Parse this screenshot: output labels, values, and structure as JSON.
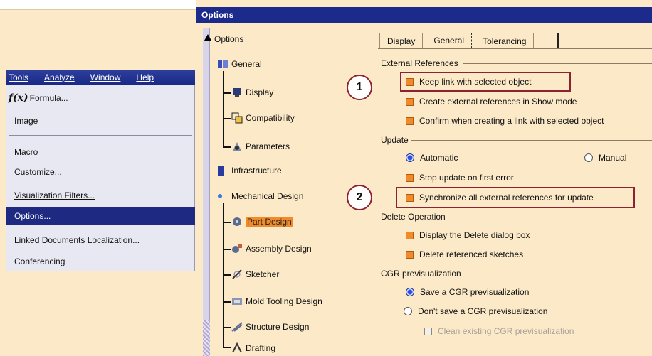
{
  "window_title": "Options",
  "menubar": {
    "items": [
      "Tools",
      "Analyze",
      "Window",
      "Help"
    ]
  },
  "tools_menu": {
    "items": [
      {
        "label": "Formula...",
        "icon": "formula-fx-icon"
      },
      {
        "label": "Image"
      },
      {
        "label": "Macro"
      },
      {
        "label": "Customize..."
      },
      {
        "label": "Visualization Filters..."
      },
      {
        "label": "Options...",
        "selected": true
      },
      {
        "label": "Linked Documents Localization..."
      },
      {
        "label": "Conferencing"
      }
    ]
  },
  "tree": {
    "root": "Options",
    "nodes": [
      {
        "label": "General",
        "icon": "general-icon"
      },
      {
        "label": "Display",
        "icon": "display-icon"
      },
      {
        "label": "Compatibility",
        "icon": "compatibility-icon"
      },
      {
        "label": "Parameters",
        "icon": "parameters-icon"
      },
      {
        "label": "Infrastructure",
        "icon": "infrastructure-icon"
      },
      {
        "label": "Mechanical Design",
        "icon": "mechanical-design-icon"
      },
      {
        "label": "Part Design",
        "icon": "part-design-icon",
        "selected": true
      },
      {
        "label": "Assembly Design",
        "icon": "assembly-design-icon"
      },
      {
        "label": "Sketcher",
        "icon": "sketcher-icon"
      },
      {
        "label": "Mold Tooling Design",
        "icon": "mold-tooling-icon"
      },
      {
        "label": "Structure Design",
        "icon": "structure-design-icon"
      },
      {
        "label": "Drafting",
        "icon": "drafting-icon"
      }
    ]
  },
  "tabs": [
    "Display",
    "General",
    "Tolerancing"
  ],
  "active_tab": "General",
  "groups": {
    "external_references": {
      "title": "External References",
      "keep_link": "Keep link with selected object",
      "create_refs": "Create external references in Show mode",
      "confirm_link": "Confirm when creating a link with selected object"
    },
    "update": {
      "title": "Update",
      "automatic": "Automatic",
      "manual": "Manual",
      "stop_update": "Stop update on first error",
      "synchronize": "Synchronize all external references for update"
    },
    "delete_operation": {
      "title": "Delete Operation",
      "display_dialog": "Display the Delete dialog box",
      "delete_sketches": "Delete referenced sketches"
    },
    "cgr": {
      "title": "CGR previsualization",
      "save": "Save a CGR previsualization",
      "dont_save": "Don't save a CGR previsualization",
      "clean": "Clean existing CGR previsualization"
    }
  },
  "callouts": [
    "1",
    "2"
  ],
  "colors": {
    "title_bar": "#1c2a8c",
    "background": "#fbe9c8",
    "checkbox": "#f08a2a",
    "highlight_box": "#8b2330",
    "menu_selected": "#1e2a82"
  }
}
